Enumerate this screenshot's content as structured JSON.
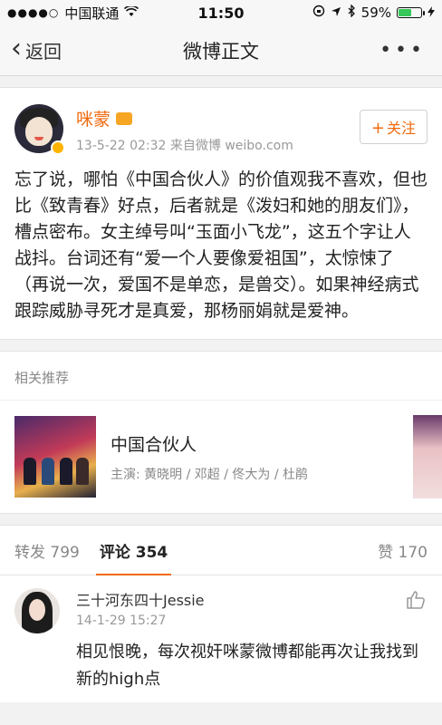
{
  "status_bar": {
    "signal_dots": "●●●●○",
    "carrier": "中国联通",
    "wifi_icon": "wifi",
    "time": "11:50",
    "battery_percent": "59%",
    "battery_level": 0.59
  },
  "nav": {
    "back_label": "返回",
    "title": "微博正文",
    "more_label": "•••"
  },
  "post": {
    "username": "咪蒙",
    "timestamp": "13-5-22 02:32",
    "source": "来自微博 weibo.com",
    "follow_label": "关注",
    "text": "忘了说，哪怕《中国合伙人》的价值观我不喜欢，但也比《致青春》好点，后者就是《泼妇和她的朋友们》，槽点密布。女主绰号叫“玉面小飞龙”，这五个字让人战抖。台词还有“爱一个人要像爱祖国”，太惊悚了（再说一次，爱国不是单恋，是兽交）。如果神经病式跟踪威胁寻死才是真爱，那杨丽娟就是爱神。"
  },
  "related": {
    "section_title": "相关推荐",
    "title": "中国合伙人",
    "cast": "主演:  黄晓明 / 邓超 / 佟大为 / 杜鹃"
  },
  "tabs": {
    "reposts": "转发 799",
    "comments": "评论 354",
    "likes": "赞 170"
  },
  "comment": {
    "username": "三十河东四十Jessie",
    "timestamp": "14-1-29 15:27",
    "text": "相见恨晚，每次视奸咪蒙微博都能再次让我找到新的high点"
  },
  "colors": {
    "accent": "#f06a0f",
    "background": "#f2f2f2"
  }
}
